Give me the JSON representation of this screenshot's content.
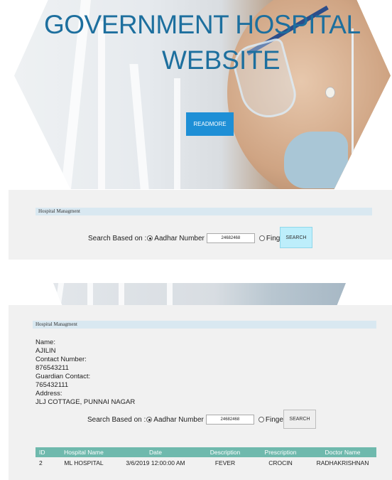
{
  "hero": {
    "title_line1": "GOVERNMENT HOSPITAL",
    "title_line2": "WEBSITE",
    "readmore_label": "READMORE"
  },
  "panel1": {
    "header": "Hospital Managment",
    "search_label": "Search Based on :",
    "radio_aadhar": "Aadhar Number",
    "aadhar_value": "24682468",
    "radio_fingerprint": "Fingerprint",
    "search_button": "SEARCH"
  },
  "panel2": {
    "header": "Hospital Managment",
    "name_label": "Name:",
    "name_value": "AJILIN",
    "contact_label": "Contact Number:",
    "contact_value": "876543211",
    "guardian_label": "Guardian Contact:",
    "guardian_value": "765432111",
    "address_label": "Address:",
    "address_value": "JLJ COTTAGE, PUNNAI NAGAR",
    "search_label": "Search Based on :",
    "radio_aadhar": "Aadhar Number",
    "aadhar_value": "24682468",
    "radio_fingerprint": "Fingerprint",
    "search_button": "SEARCH"
  },
  "table": {
    "headers": [
      "ID",
      "Hospital Name",
      "Date",
      "Description",
      "Prescription",
      "Doctor Name"
    ],
    "rows": [
      [
        "2",
        "ML HOSPITAL",
        "3/6/2019 12:00:00 AM",
        "FEVER",
        "CROCIN",
        "RADHAKRISHNAN"
      ]
    ]
  },
  "colors": {
    "title_blue": "#1d6f9e",
    "readmore_blue": "#1e8fd6",
    "table_header": "#6fb9ad",
    "strip": "#d9e8f1"
  }
}
